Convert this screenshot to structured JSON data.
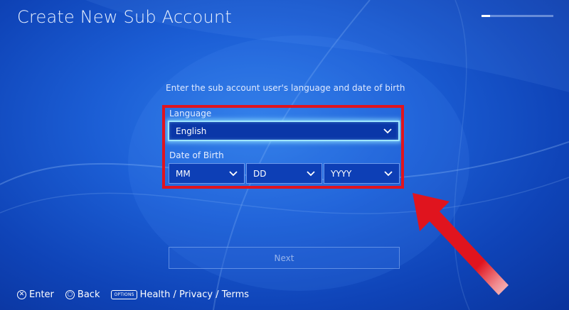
{
  "header": {
    "title": "Create New Sub Account",
    "progress_fraction": 0.12
  },
  "form": {
    "prompt": "Enter the sub account user's language and date of birth",
    "language_label": "Language",
    "language_value": "English",
    "dob_label": "Date of Birth",
    "month_value": "MM",
    "day_value": "DD",
    "year_value": "YYYY"
  },
  "actions": {
    "next_label": "Next"
  },
  "footer": {
    "enter_glyph": "✕",
    "enter_label": "Enter",
    "back_glyph": "○",
    "back_label": "Back",
    "options_badge": "OPTIONS",
    "options_label": "Health / Privacy / Terms"
  },
  "colors": {
    "background": "#1c5fd6",
    "highlight_box": "#e0141e",
    "annotation_arrow": "#e0141e",
    "focus_glow": "#9ee6ff"
  },
  "icons": {
    "dropdown": "chevron-down-icon",
    "enter": "cross-button-icon",
    "back": "circle-button-icon",
    "options": "options-button-icon",
    "annotation": "red-arrow-icon"
  }
}
